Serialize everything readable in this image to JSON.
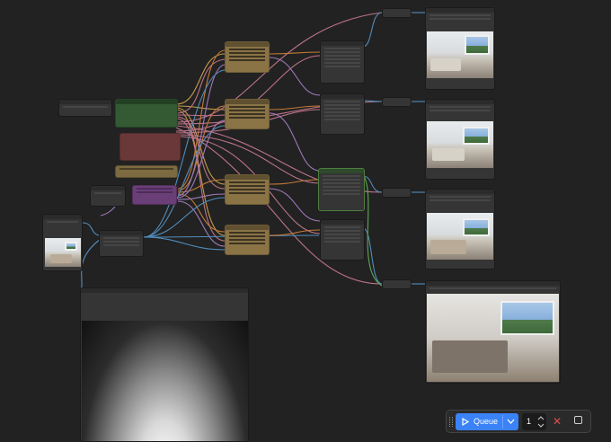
{
  "toolbar": {
    "queue_label": "Queue",
    "batch_count": "1",
    "play_icon": "play-icon",
    "dropdown_icon": "chevron-down-icon",
    "cancel_icon": "close-icon",
    "stop_icon": "square-icon",
    "drag_icon": "grip-icon"
  },
  "colors": {
    "canvas": "#222222",
    "queue_button": "#3b82f6",
    "wire_yellow": "#e0b050",
    "wire_pink": "#d9829a",
    "wire_purple": "#b48ad6",
    "wire_blue": "#5aa0d8",
    "wire_green": "#6bbf5f",
    "wire_orange": "#e08a3a"
  }
}
